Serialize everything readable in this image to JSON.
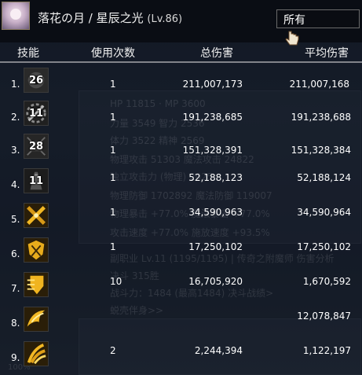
{
  "header": {
    "character": "落花の月 / 星辰之光",
    "level": "(Lv.86)",
    "filter_value": "所有"
  },
  "columns": {
    "skill": "技能",
    "uses": "使用次数",
    "total": "总伤害",
    "avg": "平均伤害"
  },
  "rows": [
    {
      "index": "1.",
      "icon": "dark-skill-icon",
      "cooldown": "26",
      "uses": "1",
      "total": "211,007,173",
      "avg": "211,007,168"
    },
    {
      "index": "2.",
      "icon": "gear-slash-skill-icon",
      "cooldown": "11",
      "uses": "1",
      "total": "191,238,685",
      "avg": "191,238,688"
    },
    {
      "index": "3.",
      "icon": "rune-skill-icon",
      "cooldown": "28",
      "uses": "1",
      "total": "151,328,391",
      "avg": "151,328,384"
    },
    {
      "index": "4.",
      "icon": "shadow-blade-skill-icon",
      "cooldown": "11",
      "uses": "1",
      "total": "52,188,123",
      "avg": "52,188,124"
    },
    {
      "index": "5.",
      "icon": "crossed-swords-skill-icon",
      "cooldown": "",
      "uses": "1",
      "total": "34,590,963",
      "avg": "34,590,964"
    },
    {
      "index": "6.",
      "icon": "shield-blades-skill-icon",
      "cooldown": "",
      "uses": "1",
      "total": "17,250,102",
      "avg": "17,250,102"
    },
    {
      "index": "7.",
      "icon": "golden-shield-skill-icon",
      "cooldown": "",
      "uses": "10",
      "total": "16,705,920",
      "avg": "1,670,592"
    },
    {
      "index": "8.",
      "icon": "golden-wing-skill-icon",
      "cooldown": "",
      "uses": "",
      "total": "",
      "avg": "12,078,847"
    },
    {
      "index": "9.",
      "icon": "golden-claw-skill-icon",
      "cooldown": "",
      "uses": "2",
      "total": "2,244,394",
      "avg": "1,122,197"
    }
  ],
  "background": {
    "lines": [
      "HP  11815  ·  MP  3600",
      "力量  3549    智力  2536",
      "体力  3522    精神  2569",
      "物理攻击  51303    魔法攻击  24822",
      "独立攻击力  (物理)    2025",
      "物理防御  1702892    魔法防御  119007",
      "物理暴击  +77.0%    魔法暴击  +77.0%",
      "攻击速度  +77.0%    施放速度  +93.5%",
      "副职业 Lv.11 (1195/1195) | 传奇之附魔师  伤害分析",
      "决斗    315胜",
      "战斗力：1484 (最高1484)    决斗战绩>",
      "蜕壳伴身>>",
      "100%"
    ]
  },
  "colors": {
    "gold": "#e8b020",
    "text": "#ffffff",
    "divider": "#dcdcdc"
  }
}
